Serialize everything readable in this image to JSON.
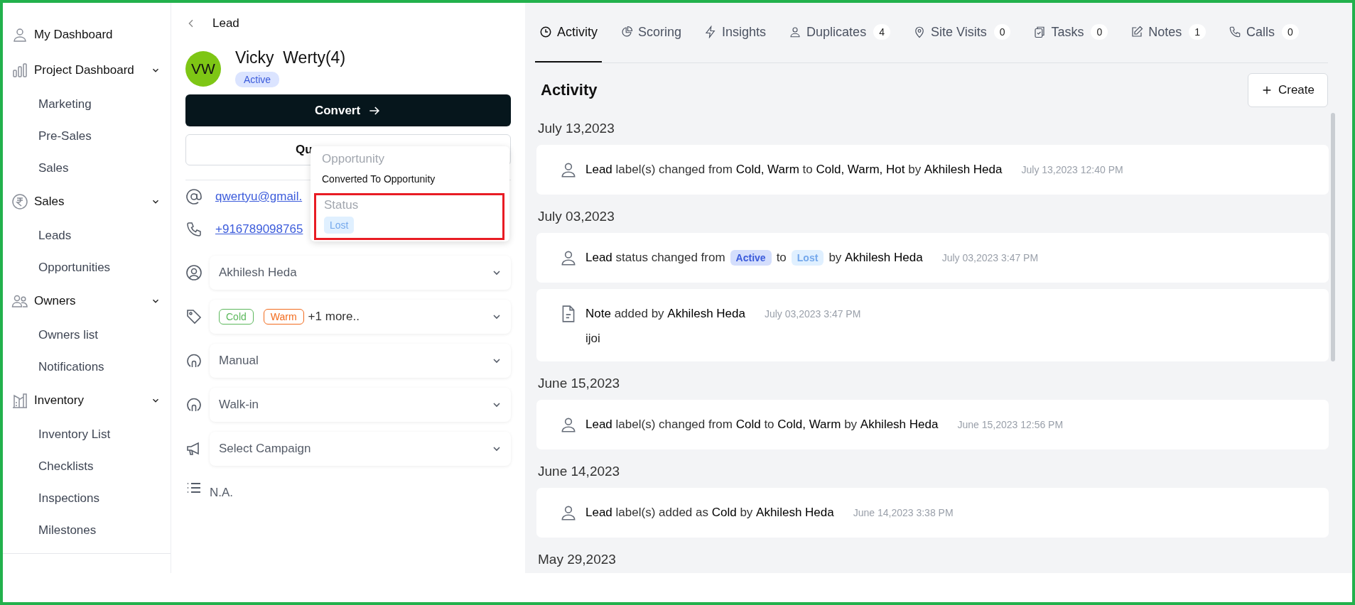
{
  "sidebar": {
    "items": [
      {
        "label": "My Dashboard"
      },
      {
        "label": "Project Dashboard",
        "expanded": true,
        "children": [
          {
            "label": "Marketing"
          },
          {
            "label": "Pre-Sales"
          },
          {
            "label": "Sales"
          }
        ]
      },
      {
        "label": "Sales",
        "expanded": true,
        "children": [
          {
            "label": "Leads"
          },
          {
            "label": "Opportunities"
          }
        ]
      },
      {
        "label": "Owners",
        "expanded": true,
        "children": [
          {
            "label": "Owners list"
          },
          {
            "label": "Notifications"
          }
        ]
      },
      {
        "label": "Inventory",
        "expanded": true,
        "children": [
          {
            "label": "Inventory List"
          },
          {
            "label": "Checklists"
          },
          {
            "label": "Inspections"
          },
          {
            "label": "Milestones"
          }
        ]
      }
    ]
  },
  "lead": {
    "breadcrumb": "Lead",
    "avatar": "VW",
    "name": "Vicky  Werty(4)",
    "status": "Active",
    "convert_button": "Convert",
    "secondary_button": "Qu",
    "email": "qwertyu@gmail.",
    "phone": "+916789098765",
    "fields": [
      {
        "kind": "owner",
        "value": "Akhilesh Heda"
      },
      {
        "kind": "tags",
        "tags": [
          {
            "label": "Cold",
            "color": "#5cb85c"
          },
          {
            "label": "Warm",
            "color": "#f26b1d"
          }
        ],
        "more": "+1 more.."
      },
      {
        "kind": "source",
        "value": "Manual"
      },
      {
        "kind": "source",
        "value": "Walk-in"
      },
      {
        "kind": "campaign",
        "value": "Select Campaign"
      },
      {
        "kind": "list",
        "value": "N.A."
      }
    ]
  },
  "popup": {
    "sections": [
      {
        "heading": "Opportunity",
        "value": "Converted To Opportunity",
        "highlighted": false
      },
      {
        "heading": "Status",
        "badge": "Lost",
        "highlighted": true
      }
    ]
  },
  "tabs": [
    {
      "label": "Activity",
      "selected": true
    },
    {
      "label": "Scoring",
      "selected": false
    },
    {
      "label": "Insights",
      "selected": false
    },
    {
      "label": "Duplicates",
      "count": "4",
      "selected": false
    },
    {
      "label": "Site Visits",
      "count": "0",
      "selected": false
    },
    {
      "label": "Tasks",
      "count": "0",
      "selected": false
    },
    {
      "label": "Notes",
      "count": "1",
      "selected": false
    },
    {
      "label": "Calls",
      "count": "0",
      "selected": false
    }
  ],
  "activity": {
    "title": "Activity",
    "create_button": "Create",
    "groups": [
      {
        "date": "July 13,2023",
        "entries": [
          {
            "kind": "change",
            "text": "**Lead** label(s) changed from **Cold, Warm** to **Cold, Warm, Hot** by **Akhilesh Heda**",
            "time": "July 13,2023 12:40 PM"
          }
        ]
      },
      {
        "date": "July 03,2023",
        "entries": [
          {
            "kind": "status",
            "prefix": "**Lead** status changed from",
            "from": "Active",
            "joiner": "to",
            "to": "Lost",
            "suffix": "by **Akhilesh Heda**",
            "time": "July 03,2023 3:47 PM"
          },
          {
            "kind": "note",
            "text": "**Note** added by **Akhilesh Heda**",
            "time": "July 03,2023 3:47 PM",
            "body": "ijoi"
          }
        ]
      },
      {
        "date": "June 15,2023",
        "entries": [
          {
            "kind": "change",
            "text": "**Lead** label(s) changed from **Cold** to **Cold, Warm** by **Akhilesh Heda**",
            "time": "June 15,2023 12:56 PM"
          }
        ]
      },
      {
        "date": "June 14,2023",
        "entries": [
          {
            "kind": "change",
            "text": "**Lead** label(s) added as **Cold** by **Akhilesh Heda**",
            "time": "June 14,2023 3:38 PM"
          }
        ]
      },
      {
        "date": "May 29,2023"
      }
    ]
  }
}
